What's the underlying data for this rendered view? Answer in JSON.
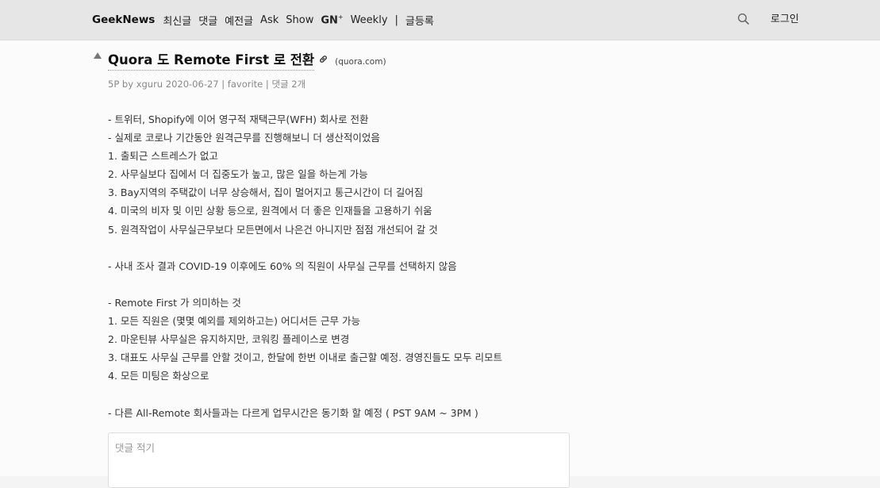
{
  "nav": {
    "brand": "GeekNews",
    "links": [
      "최신글",
      "댓글",
      "예전글",
      "Ask",
      "Show"
    ],
    "gn_label": "GN",
    "gn_sup": "+",
    "weekly": "Weekly",
    "separator": "|",
    "submit": "글등록",
    "search_icon": "search-icon",
    "login": "로그인"
  },
  "post": {
    "title": "Quora 도 Remote First 로 전환",
    "domain": "(quora.com)",
    "meta_points": "5P",
    "meta_by": "by",
    "meta_author": "xguru",
    "meta_date": "2020-06-27",
    "meta_sep": "|",
    "meta_favorite": "favorite",
    "meta_comments": "댓글 2개",
    "body_lines": [
      "- 트위터, Shopify에 이어 영구적 재택근무(WFH) 회사로 전환",
      "- 실제로 코로나 기간동안 원격근무를 진행해보니 더 생산적이었음",
      "1. 출퇴근 스트레스가 없고",
      "2. 사무실보다 집에서 더 집중도가 높고, 많은 일을 하는게 가능",
      "3. Bay지역의 주택값이 너무 상승해서, 집이 멀어지고 통근시간이 더 길어짐",
      "4. 미국의 비자 및 이민 상황 등으로, 원격에서 더 좋은 인재들을 고용하기 쉬움",
      "5. 원격작업이 사무실근무보다 모든면에서 나은건 아니지만 점점 개선되어 갈 것",
      "",
      "- 사내 조사 결과 COVID-19 이후에도 60% 의 직원이 사무실 근무를 선택하지 않음",
      "",
      "- Remote First 가 의미하는 것",
      "1. 모든 직원은 (몇몇 예외를 제외하고는) 어디서든 근무 가능",
      "2. 마운틴뷰 사무실은 유지하지만, 코워킹 플레이스로 변경",
      "3. 대표도 사무실 근무를 안할 것이고, 한달에 한번 이내로 출근할 예정. 경영진들도 모두 리모트",
      "4. 모든 미팅은 화상으로",
      "",
      "- 다른 All-Remote 회사들과는 다르게 업무시간은 동기화 할 예정 ( PST 9AM ~ 3PM )"
    ]
  },
  "comment": {
    "placeholder": "댓글 적기"
  }
}
